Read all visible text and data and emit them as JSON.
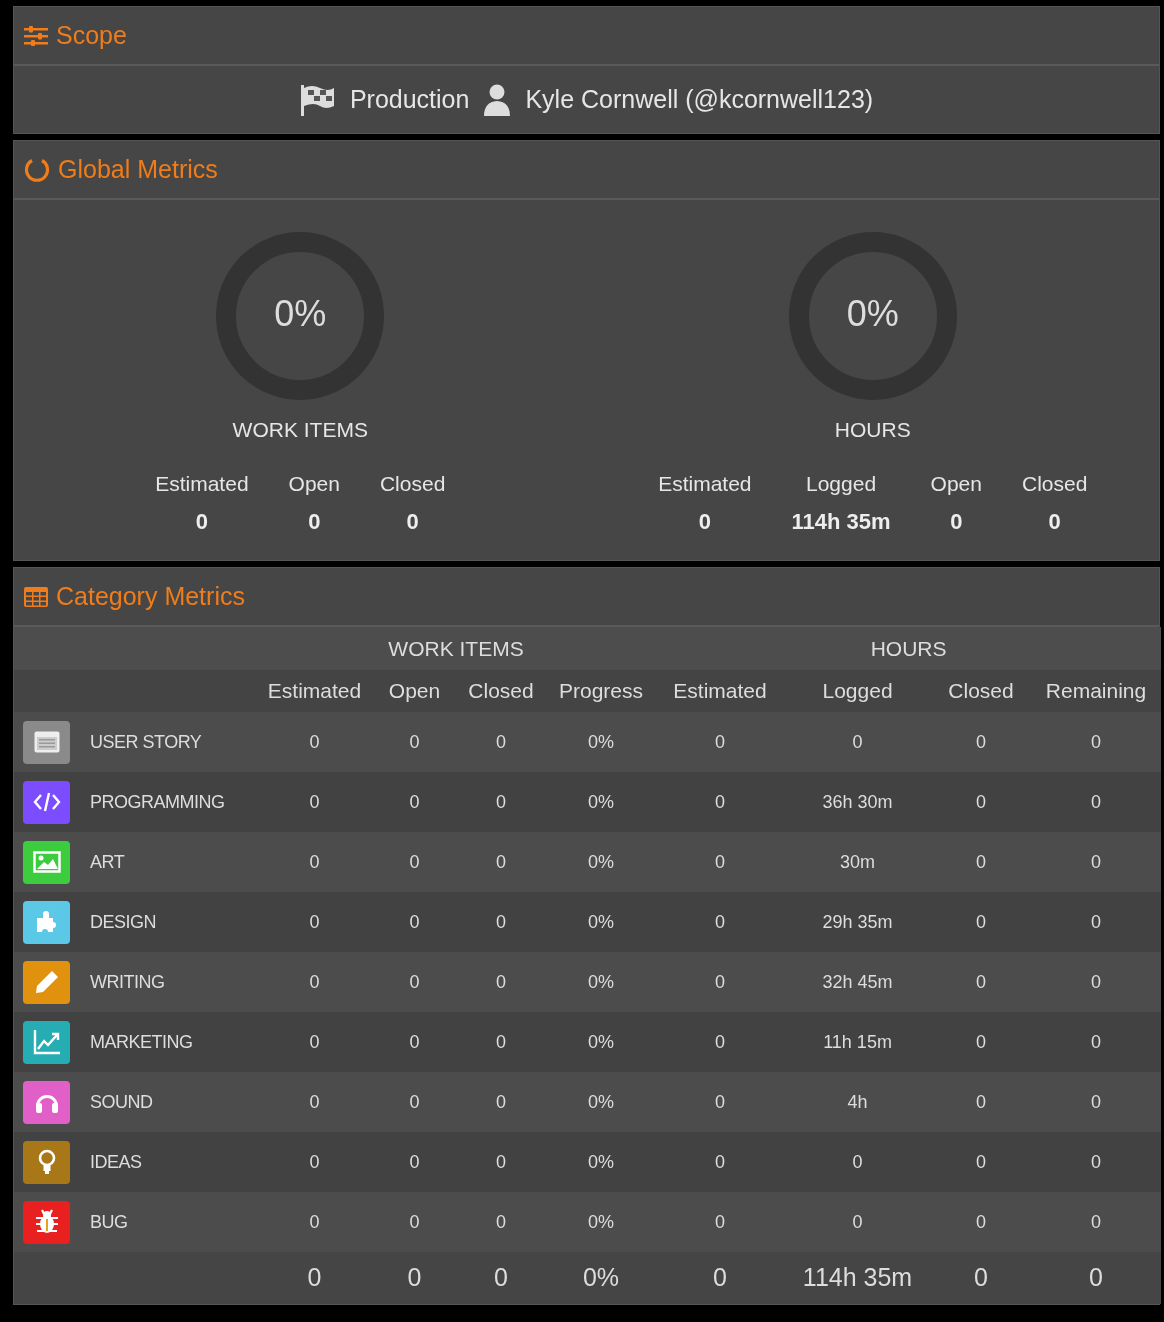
{
  "scope": {
    "title": "Scope",
    "project": "Production",
    "user": "Kyle Cornwell (@kcornwell123)"
  },
  "global_metrics": {
    "title": "Global Metrics",
    "gauges": [
      {
        "percent": "0%",
        "level": 0,
        "label": "WORK ITEMS",
        "stats": [
          {
            "label": "Estimated",
            "value": "0"
          },
          {
            "label": "Open",
            "value": "0"
          },
          {
            "label": "Closed",
            "value": "0"
          }
        ]
      },
      {
        "percent": "0%",
        "level": 0,
        "label": "HOURS",
        "stats": [
          {
            "label": "Estimated",
            "value": "0"
          },
          {
            "label": "Logged",
            "value": "114h 35m"
          },
          {
            "label": "Open",
            "value": "0"
          },
          {
            "label": "Closed",
            "value": "0"
          }
        ]
      }
    ]
  },
  "category_metrics": {
    "title": "Category Metrics",
    "groups": [
      "WORK ITEMS",
      "HOURS"
    ],
    "columns": [
      "Estimated",
      "Open",
      "Closed",
      "Progress",
      "Estimated",
      "Logged",
      "Closed",
      "Remaining"
    ],
    "rows": [
      {
        "name": "USER STORY",
        "color": "#8a8a8a",
        "values": [
          "0",
          "0",
          "0",
          "0%",
          "0",
          "0",
          "0",
          "0"
        ]
      },
      {
        "name": "PROGRAMMING",
        "color": "#7c4dff",
        "values": [
          "0",
          "0",
          "0",
          "0%",
          "0",
          "36h 30m",
          "0",
          "0"
        ]
      },
      {
        "name": "ART",
        "color": "#3dcc3d",
        "values": [
          "0",
          "0",
          "0",
          "0%",
          "0",
          "30m",
          "0",
          "0"
        ]
      },
      {
        "name": "DESIGN",
        "color": "#5cc8e8",
        "values": [
          "0",
          "0",
          "0",
          "0%",
          "0",
          "29h 35m",
          "0",
          "0"
        ]
      },
      {
        "name": "WRITING",
        "color": "#e0920f",
        "values": [
          "0",
          "0",
          "0",
          "0%",
          "0",
          "32h 45m",
          "0",
          "0"
        ]
      },
      {
        "name": "MARKETING",
        "color": "#26adb4",
        "values": [
          "0",
          "0",
          "0",
          "0%",
          "0",
          "11h 15m",
          "0",
          "0"
        ]
      },
      {
        "name": "SOUND",
        "color": "#e060c8",
        "values": [
          "0",
          "0",
          "0",
          "0%",
          "0",
          "4h",
          "0",
          "0"
        ]
      },
      {
        "name": "IDEAS",
        "color": "#a87818",
        "values": [
          "0",
          "0",
          "0",
          "0%",
          "0",
          "0",
          "0",
          "0"
        ]
      },
      {
        "name": "BUG",
        "color": "#e82020",
        "values": [
          "0",
          "0",
          "0",
          "0%",
          "0",
          "0",
          "0",
          "0"
        ]
      }
    ],
    "totals": [
      "0",
      "0",
      "0",
      "0%",
      "0",
      "114h 35m",
      "0",
      "0"
    ]
  }
}
